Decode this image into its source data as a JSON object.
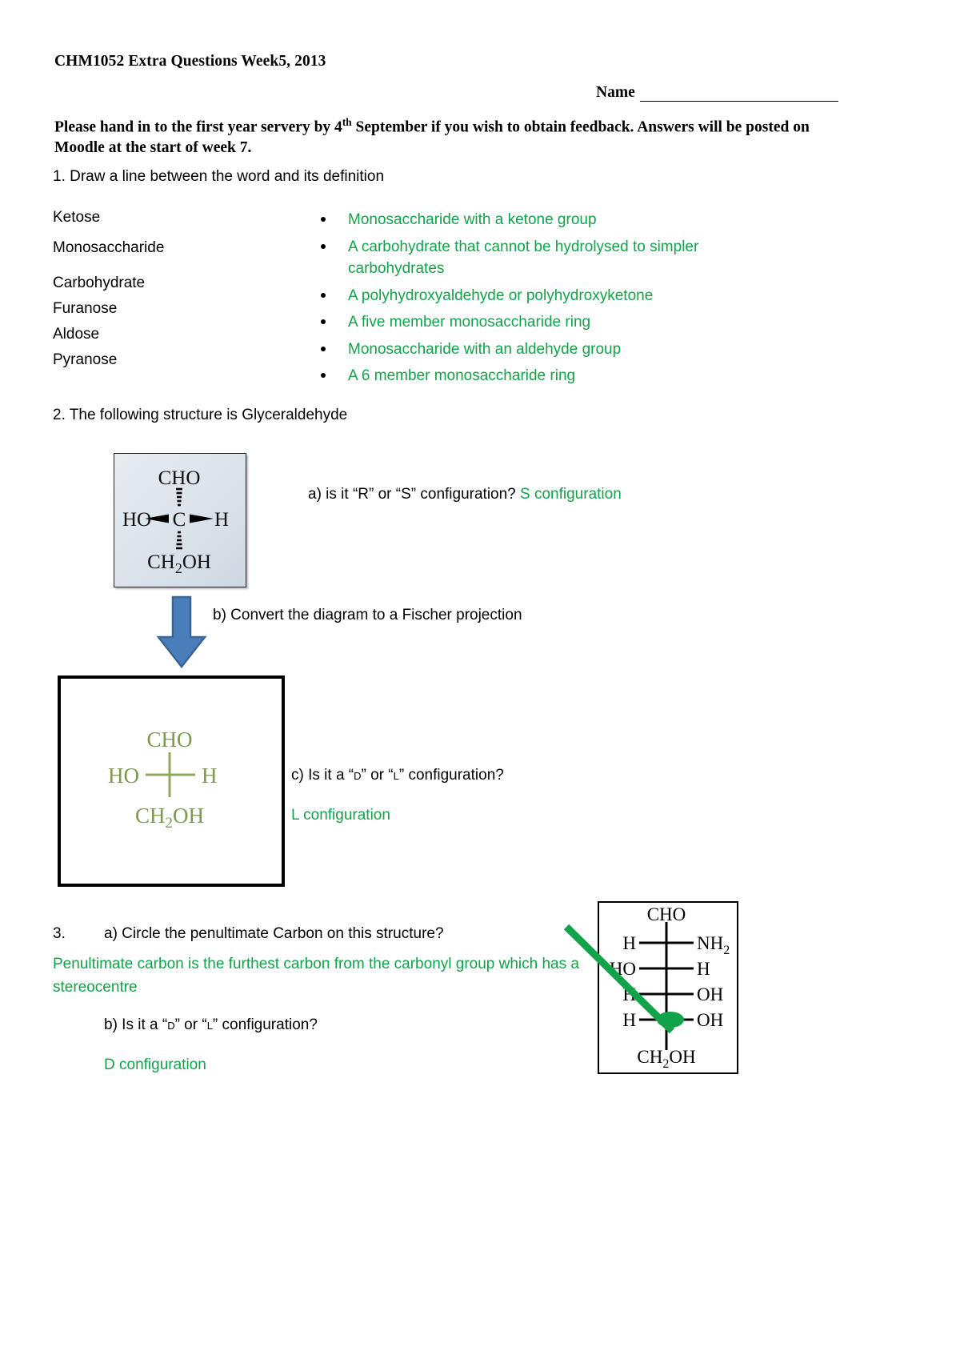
{
  "header": {
    "title": "CHM1052 Extra Questions Week5, 2013",
    "name_label": "Name",
    "instructions_pre": "Please hand in to the first year servery by 4",
    "instructions_sup": "th",
    "instructions_post": " September if you wish to obtain feedback. Answers will be posted on Moodle at the start of week 7."
  },
  "colors": {
    "answer_green": "#12A24A",
    "fischer_olive": "#7B9A4E",
    "arrow_blue": "#4A7EBB",
    "circle_green": "#12A24A"
  },
  "q1": {
    "prompt": "1.  Draw a line between the word and its definition",
    "words": [
      "Ketose",
      "Monosaccharide",
      "Carbohydrate",
      "Furanose",
      "Aldose",
      "Pyranose"
    ],
    "definitions": [
      "Monosaccharide with a ketone group",
      "A carbohydrate that cannot be hydrolysed to simpler carbohydrates",
      "A polyhydroxyaldehyde or polyhydroxyketone",
      "A five member monosaccharide ring",
      "Monosaccharide with an aldehyde group",
      "A 6 member monosaccharide ring"
    ]
  },
  "q2": {
    "prompt": "2. The following structure is Glyceraldehyde",
    "structure": {
      "top": "CHO",
      "left": "HO",
      "center": "C",
      "right": "H",
      "bottom": "CH2OH",
      "bottom_sub": "2"
    },
    "part_a_question": "a) is it “R” or “S” configuration?",
    "part_a_answer": "S configuration",
    "part_b_question": "b) Convert the diagram to a Fischer projection",
    "fischer": {
      "top": "CHO",
      "left": "HO",
      "right": "H",
      "bottom": "CH2OH"
    },
    "part_c_question_pre": "c) Is it a “",
    "part_c_d": "D",
    "part_c_mid": "” or “",
    "part_c_l": "L",
    "part_c_post": "” configuration?",
    "part_c_answer": "L configuration"
  },
  "q3": {
    "number": "3.",
    "part_a_question": "a) Circle the penultimate Carbon on this structure?",
    "part_a_answer": "Penultimate carbon is the furthest carbon from the carbonyl group which has a stereocentre",
    "part_b_question_pre": "b) Is it a “",
    "part_b_d": "D",
    "part_b_mid": "” or “",
    "part_b_l": "L",
    "part_b_post": "” configuration?",
    "part_b_answer": "D configuration",
    "fischer_rows": [
      {
        "left": "H",
        "right": "NH2",
        "right_sub": "2",
        "circled": false
      },
      {
        "left": "HO",
        "right": "H",
        "right_sub": "",
        "circled": false
      },
      {
        "left": "H",
        "right": "OH",
        "right_sub": "",
        "circled": false
      },
      {
        "left": "H",
        "right": "OH",
        "right_sub": "",
        "circled": true
      }
    ],
    "fischer_top": "CHO",
    "fischer_bottom": "CH2OH"
  }
}
